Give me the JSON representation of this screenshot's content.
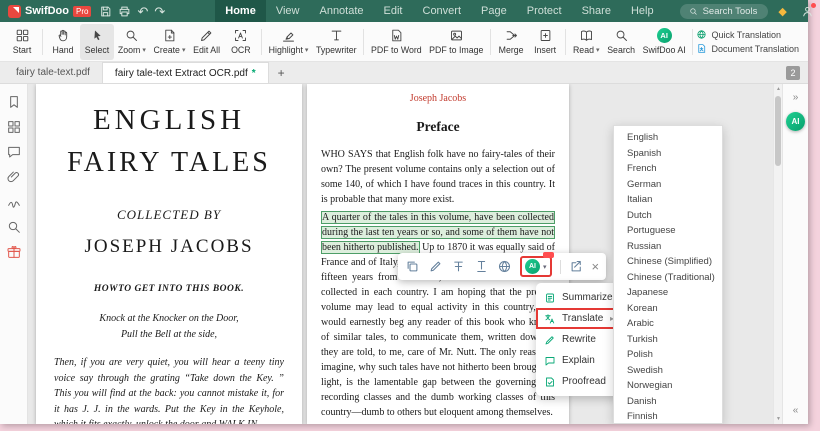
{
  "colors": {
    "titlebar": "#2e6b5a",
    "accent_green": "#0aa87a",
    "annotation_red": "#e53935",
    "brand_red": "#e8483f",
    "highlight_border": "#4d9e67"
  },
  "glyphs": {
    "caret_down": "▾",
    "undo": "↶",
    "redo": "↷",
    "close": "×",
    "plus": "+",
    "submenu_arrow": "▸",
    "collapse_left": "«",
    "collapse_right": "»",
    "scroll_up": "▲",
    "scroll_down": "▼",
    "premium": "◆",
    "modified": "*"
  },
  "titlebar": {
    "brand": "SwifDoo",
    "brand_badge": "Pro",
    "menus": [
      "Home",
      "View",
      "Annotate",
      "Edit",
      "Convert",
      "Page",
      "Protect",
      "Share",
      "Help"
    ],
    "search_placeholder": "Search Tools"
  },
  "ribbon": {
    "buttons": [
      {
        "label": "Start"
      },
      {
        "label": "Hand"
      },
      {
        "label": "Select"
      },
      {
        "label": "Zoom"
      },
      {
        "label": "Create"
      },
      {
        "label": "Edit All"
      },
      {
        "label": "OCR"
      },
      {
        "label": "Highlight"
      },
      {
        "label": "Typewriter"
      },
      {
        "label": "PDF to Word"
      },
      {
        "label": "PDF to Image"
      },
      {
        "label": "Merge"
      },
      {
        "label": "Insert"
      },
      {
        "label": "Read"
      },
      {
        "label": "Search"
      },
      {
        "label": "SwifDoo AI"
      }
    ],
    "ai_badge": "AI",
    "right_actions": [
      {
        "label": "Quick Translation"
      },
      {
        "label": "Document Translation"
      }
    ]
  },
  "tabbar": {
    "tabs": [
      {
        "label": "fairy tale-text.pdf"
      },
      {
        "label": "fairy tale-text Extract OCR.pdf"
      }
    ],
    "counter": "2"
  },
  "document": {
    "left_page": {
      "title_line1": "ENGLISH",
      "title_line2": "FAIRY TALES",
      "collected_by": "COLLECTED BY",
      "author": "JOSEPH JACOBS",
      "howto": "HOWTO GET INTO THIS BOOK.",
      "verse1": "Knock at the Knocker on the Door,",
      "verse2": "Pull the Bell at the side,",
      "paragraph": "Then, if you are very quiet, you will hear a teeny tiny voice say through the grating “Take down the Key. ” This you will find at the back: you cannot mistake it, for it has J. J. in the wards. Put the Key in the Keyhole, which it fits exactly, unlock the door and WALK IN."
    },
    "right_page": {
      "header": "Joseph Jacobs",
      "heading": "Preface",
      "para1": "WHO SAYS that English folk have no fairy-tales of their own? The present volume contains only a selection out of some 140, of which I have found traces in this country. It is probable that many more exist.",
      "highlighted": "A quarter of the tales in this volume, have been collected during the last ten years or so, and some of them have not been hitherto published.",
      "para2_rest": " Up to 1870 it was equally said of France and of Italy, that they had no folk-tales. Yet within fifteen years from that date, over 1000 tales had been collected in each country. I am hoping that the present volume may lead to equal activity in this country, and would earnestly beg any reader of this book who knows of similar tales, to communicate them, written down as they are told, to me, care of Mr. Nutt. The only reason, I imagine, why such tales have not hitherto been brought to light, is the lamentable gap between the governing and recording classes and the dumb working classes of this country—dumb to others but eloquent among themselves."
    }
  },
  "popup_toolbar": {
    "ai_label": "AI"
  },
  "ai_menu": {
    "items": [
      {
        "label": "Summarize"
      },
      {
        "label": "Translate"
      },
      {
        "label": "Rewrite"
      },
      {
        "label": "Explain"
      },
      {
        "label": "Proofread"
      }
    ]
  },
  "language_menu": {
    "items": [
      "English",
      "Spanish",
      "French",
      "German",
      "Italian",
      "Dutch",
      "Portuguese",
      "Russian",
      "Chinese (Simplified)",
      "Chinese (Traditional)",
      "Japanese",
      "Korean",
      "Arabic",
      "Turkish",
      "Polish",
      "Swedish",
      "Norwegian",
      "Danish",
      "Finnish"
    ]
  },
  "right_rail": {
    "ai_label": "AI"
  }
}
